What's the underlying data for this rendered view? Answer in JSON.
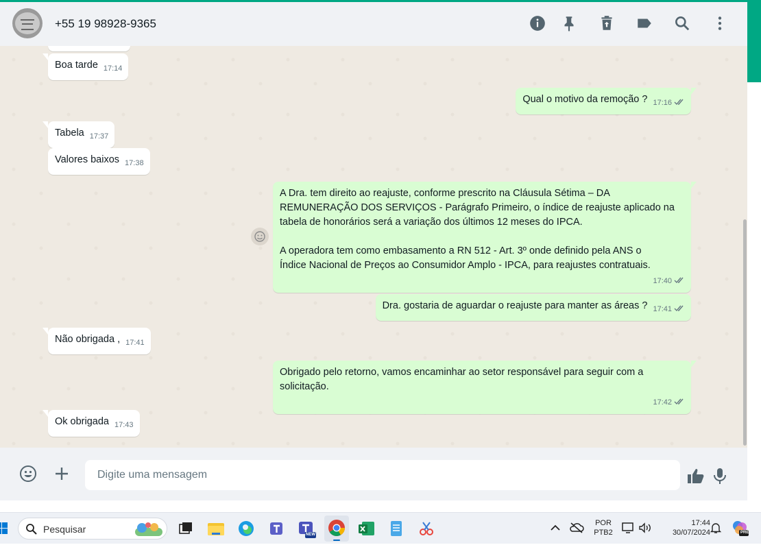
{
  "header": {
    "contact": "+55 19 98928-9365"
  },
  "messages": [
    {
      "dir": "in",
      "text": "Boa tarde",
      "time": "17:14"
    },
    {
      "dir": "out",
      "text": "Qual o motivo da remoção ?",
      "time": "17:16"
    },
    {
      "dir": "in",
      "text": "Tabela",
      "time": "17:37"
    },
    {
      "dir": "in",
      "text": "Valores baixos",
      "time": "17:38"
    },
    {
      "dir": "out",
      "text": "A Dra. tem direito ao reajuste, conforme prescrito na Cláusula Sétima – DA\nREMUNERAÇÃO DOS SERVIÇOS - Parágrafo Primeiro, o índice de reajuste aplicado na\ntabela de honorários será a variação dos últimos 12 meses do IPCA.\n\nA operadora tem como embasamento a RN 512 - Art. 3º onde definido pela ANS o\nÍndice Nacional de Preços ao Consumidor Amplo - IPCA, para reajustes contratuais.",
      "time": "17:40"
    },
    {
      "dir": "out",
      "text": "Dra. gostaria de aguardar o reajuste para manter as áreas ?",
      "time": "17:41"
    },
    {
      "dir": "in",
      "text": "Não obrigada ,",
      "time": "17:41"
    },
    {
      "dir": "out",
      "text": "Obrigado pelo retorno, vamos encaminhar ao setor responsável para seguir com a\nsolicitação.",
      "time": "17:42"
    },
    {
      "dir": "in",
      "text": "Ok obrigada",
      "time": "17:43"
    }
  ],
  "composer": {
    "placeholder": "Digite uma mensagem"
  },
  "taskbar": {
    "search_label": "Pesquisar",
    "lang_top": "POR",
    "lang_bottom": "PTB2",
    "time": "17:44",
    "date": "30/07/2024",
    "copilot_badge": "PRE",
    "teams_badge": "NEW"
  },
  "colors": {
    "accent": "#00a884",
    "outgoing": "#d9fdd3",
    "incoming": "#ffffff",
    "wallpaper": "#efeae2"
  }
}
